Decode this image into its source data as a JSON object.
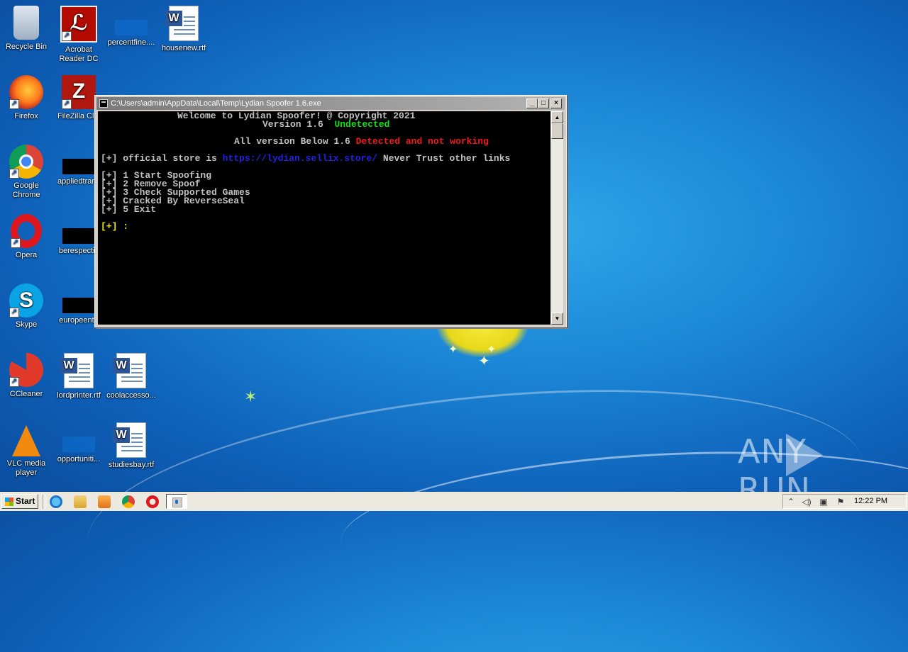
{
  "desktop": {
    "icons": [
      {
        "id": "recycle-bin",
        "label": "Recycle Bin",
        "label2": ""
      },
      {
        "id": "acrobat",
        "label": "Acrobat",
        "label2": "Reader DC"
      },
      {
        "id": "percentfine",
        "label": "percentfine....",
        "label2": ""
      },
      {
        "id": "housenew",
        "label": "housenew.rtf",
        "label2": ""
      },
      {
        "id": "firefox",
        "label": "Firefox",
        "label2": ""
      },
      {
        "id": "filezilla",
        "label": "FileZilla Clie",
        "label2": ""
      },
      {
        "id": "chrome",
        "label": "Google",
        "label2": "Chrome"
      },
      {
        "id": "appliedtrans",
        "label": "appliedtrans",
        "label2": ""
      },
      {
        "id": "opera",
        "label": "Opera",
        "label2": ""
      },
      {
        "id": "berespective",
        "label": "berespectiv",
        "label2": ""
      },
      {
        "id": "skype",
        "label": "Skype",
        "label2": ""
      },
      {
        "id": "europeente",
        "label": "europeente",
        "label2": ""
      },
      {
        "id": "ccleaner",
        "label": "CCleaner",
        "label2": ""
      },
      {
        "id": "lordprinter",
        "label": "lordprinter.rtf",
        "label2": ""
      },
      {
        "id": "coolaccesso",
        "label": "coolaccesso...",
        "label2": ""
      },
      {
        "id": "vlc",
        "label": "VLC media",
        "label2": "player"
      },
      {
        "id": "opportuniti",
        "label": "opportuniti...",
        "label2": ""
      },
      {
        "id": "studiesbay",
        "label": "studiesbay.rtf",
        "label2": ""
      }
    ],
    "watermark": "ANY RUN"
  },
  "console_window": {
    "title": "C:\\Users\\admin\\AppData\\Local\\Temp\\Lydian Spoofer 1.6.exe",
    "buttons": {
      "minimize": "_",
      "maximize": "□",
      "close": "×"
    },
    "lines": {
      "welcome": "Welcome to Lydian Spoofer! @ Copyright 2021",
      "version": "Version 1.6",
      "undetected": "Undetected",
      "below_prefix": "All version Below 1.6",
      "below_status": "Detected and not working",
      "store_prefix": "[+] official store is",
      "store_url": "https://lydian.sellix.store/",
      "store_suffix": "Never Trust other links",
      "menu1": "[+] 1 Start Spoofing",
      "menu2": "[+] 2 Remove Spoof",
      "menu3": "[+] 3 Check Supported Games",
      "menu4": "[+] Cracked By ReverseSeal",
      "menu5": "[+] 5 Exit",
      "prompt": "[+] :"
    },
    "colors": {
      "green": "#13e013",
      "red": "#f21a1a",
      "blue": "#2121e8",
      "yellow": "#e8e800"
    }
  },
  "taskbar": {
    "start_label": "Start",
    "clock": "12:22 PM"
  }
}
